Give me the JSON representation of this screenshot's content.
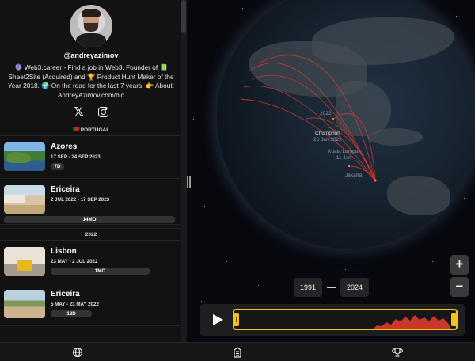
{
  "profile": {
    "handle": "@andreyazimov",
    "bio": "🔮 Web3.career - Find a job in Web3. Founder of 📗 Sheet2Site (Acquired) and 🏆 Product Hunt Maker of the Year 2018. 🌍 On the road for the last 7 years. 👉 About: AndreyAzimov.com/bio",
    "x_icon_glyph": "𝕏"
  },
  "sections": [
    {
      "title": "PORTUGAL"
    },
    {
      "title": "2022"
    }
  ],
  "trips": [
    {
      "name": "Azores",
      "dates": "17 SEP - 24 SEP 2023",
      "duration": "7D"
    },
    {
      "name": "Ericeira",
      "dates": "2 JUL 2022 - 17 SEP 2023",
      "duration": "14MO"
    },
    {
      "name": "Lisbon",
      "dates": "23 MAY - 2 JUL 2022",
      "duration": "1MO"
    },
    {
      "name": "Ericeira",
      "dates": "5 MAY - 23 MAY 2022",
      "duration": "18D"
    }
  ],
  "map": {
    "labels": [
      {
        "city": "Chumphon",
        "date": "26 Jan 2022"
      },
      {
        "city": "Kuala Lumpur",
        "date": "11 Jan"
      },
      {
        "city": "Jakarta",
        "date": ""
      },
      {
        "city": "",
        "date": "2022"
      }
    ],
    "arc_color": "#e0392e",
    "zoom_in": "+",
    "zoom_out": "−"
  },
  "timeline": {
    "start_year": "1991",
    "end_year": "2024",
    "highlight_color": "#f5c21b",
    "activity_color": "#c8362c"
  },
  "nav": {
    "items": [
      "globe-icon",
      "building-icon",
      "trophy-icon"
    ]
  }
}
